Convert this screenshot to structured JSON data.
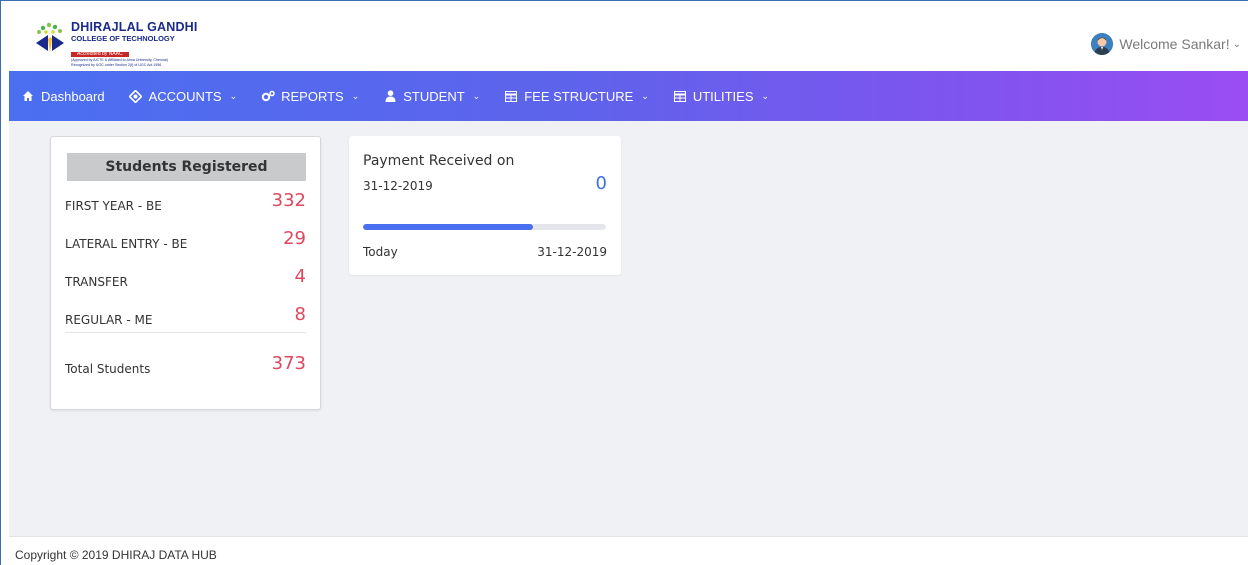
{
  "header": {
    "logo": {
      "line1": "DHIRAJLAL GANDHI",
      "line2": "COLLEGE OF TECHNOLOGY",
      "line3": "Accredited by NAAC",
      "line4": "(Approved by AICTE & Affiliated to Anna University, Chennai)",
      "line5": "Recognized by UGC under Section 2(f) of UGC Act 1956"
    },
    "welcome": "Welcome Sankar!",
    "avatar_icon": "user-avatar-icon"
  },
  "nav": {
    "items": [
      {
        "label": "Dashboard",
        "icon": "home-icon",
        "dropdown": false
      },
      {
        "label": "ACCOUNTS",
        "icon": "accounts-icon",
        "dropdown": true
      },
      {
        "label": "REPORTS",
        "icon": "cogs-icon",
        "dropdown": true
      },
      {
        "label": "STUDENT",
        "icon": "user-icon",
        "dropdown": true
      },
      {
        "label": "FEE STRUCTURE",
        "icon": "table-icon",
        "dropdown": true
      },
      {
        "label": "UTILITIES",
        "icon": "table-icon",
        "dropdown": true
      }
    ]
  },
  "students_card": {
    "title": "Students Registered",
    "rows": [
      {
        "label": "FIRST YEAR - BE",
        "value": "332"
      },
      {
        "label": "LATERAL ENTRY - BE",
        "value": "29"
      },
      {
        "label": "TRANSFER",
        "value": "4"
      },
      {
        "label": "REGULAR - ME",
        "value": "8"
      }
    ],
    "total_label": "Total Students",
    "total_value": "373"
  },
  "payment_card": {
    "title": "Payment Received on",
    "date": "31-12-2019",
    "count": "0",
    "progress_fraction": 0.7,
    "footer_left": "Today",
    "footer_right": "31-12-2019"
  },
  "colors": {
    "accent_red": "#e0465e",
    "accent_blue": "#3f6ee8",
    "nav_gradient_start": "#4a6ff0",
    "nav_gradient_end": "#9a4df2"
  },
  "footer": {
    "text": "Copyright © 2019 DHIRAJ DATA HUB"
  }
}
